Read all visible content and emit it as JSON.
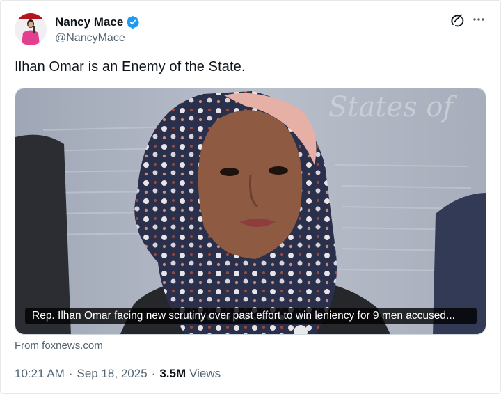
{
  "author": {
    "display_name": "Nancy Mace",
    "handle": "@NancyMace",
    "verified": true
  },
  "icons": {
    "verified": "verified-badge-icon",
    "grok": "grok-icon",
    "more": "more-options-icon"
  },
  "tweet": {
    "text": "Ilhan Omar is an Enemy of the State."
  },
  "link_card": {
    "caption": "Rep. Ilhan Omar facing new scrutiny over past effort to win leniency for 9 men accused...",
    "source": "From foxnews.com"
  },
  "meta": {
    "time": "10:21 AM",
    "separator": "·",
    "date": "Sep 18, 2025",
    "views_count": "3.5M",
    "views_label": "Views"
  },
  "colors": {
    "verified_blue": "#1d9bf0",
    "text_primary": "#0f1419",
    "text_secondary": "#536471",
    "border": "#cfd9de"
  }
}
